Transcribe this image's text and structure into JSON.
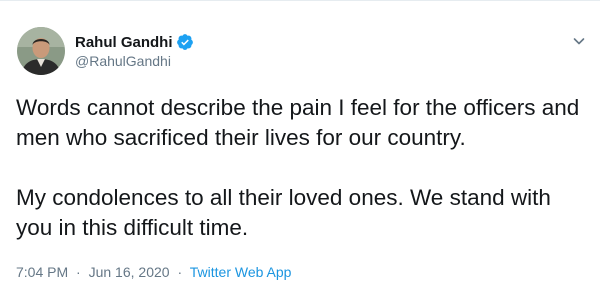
{
  "user": {
    "display_name": "Rahul Gandhi",
    "handle": "@RahulGandhi",
    "verified": true
  },
  "tweet": {
    "paragraph_1": "Words cannot describe the pain I feel for the officers and men who sacrificed their lives for our country.",
    "paragraph_2": "My condolences to all their loved ones. We stand with you in this difficult time."
  },
  "meta": {
    "time": "7:04 PM",
    "date": "Jun 16, 2020",
    "separator": "·",
    "source": "Twitter Web App"
  },
  "colors": {
    "text": "#14171a",
    "secondary": "#657786",
    "accent": "#1b95e0",
    "verified": "#1da1f2"
  },
  "icons": {
    "verified": "verified-badge-icon",
    "caret": "chevron-down-icon"
  }
}
